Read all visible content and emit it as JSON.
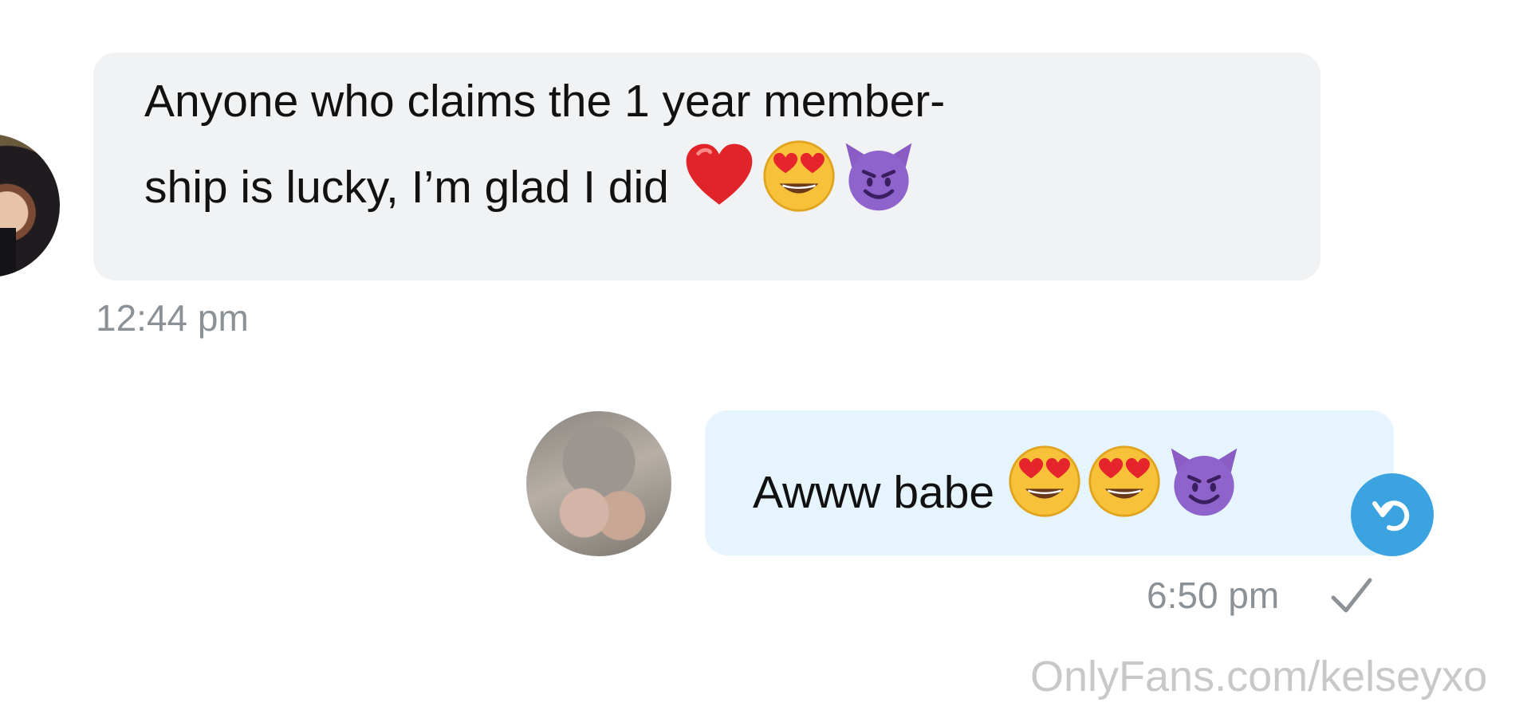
{
  "messages": [
    {
      "direction": "incoming",
      "lines": [
        "Anyone who claims the 1 year member-",
        "ship is lucky, I’m glad I did"
      ],
      "emojis": [
        "red-heart",
        "heart-eyes",
        "smiling-imp"
      ],
      "time": "12:44 pm"
    },
    {
      "direction": "outgoing",
      "lines": [
        "Awww babe"
      ],
      "emojis": [
        "heart-eyes",
        "heart-eyes",
        "smiling-imp"
      ],
      "time": "6:50 pm",
      "status_icon": "check-icon"
    }
  ],
  "reply_icon": "undo-arrow-icon",
  "watermark": "OnlyFans.com/kelseyxo",
  "colors": {
    "incoming_bubble": "#f1f2f4",
    "outgoing_bubble": "#e5f4fd",
    "accent": "#3aa3e0",
    "timestamp": "#8a9197"
  }
}
